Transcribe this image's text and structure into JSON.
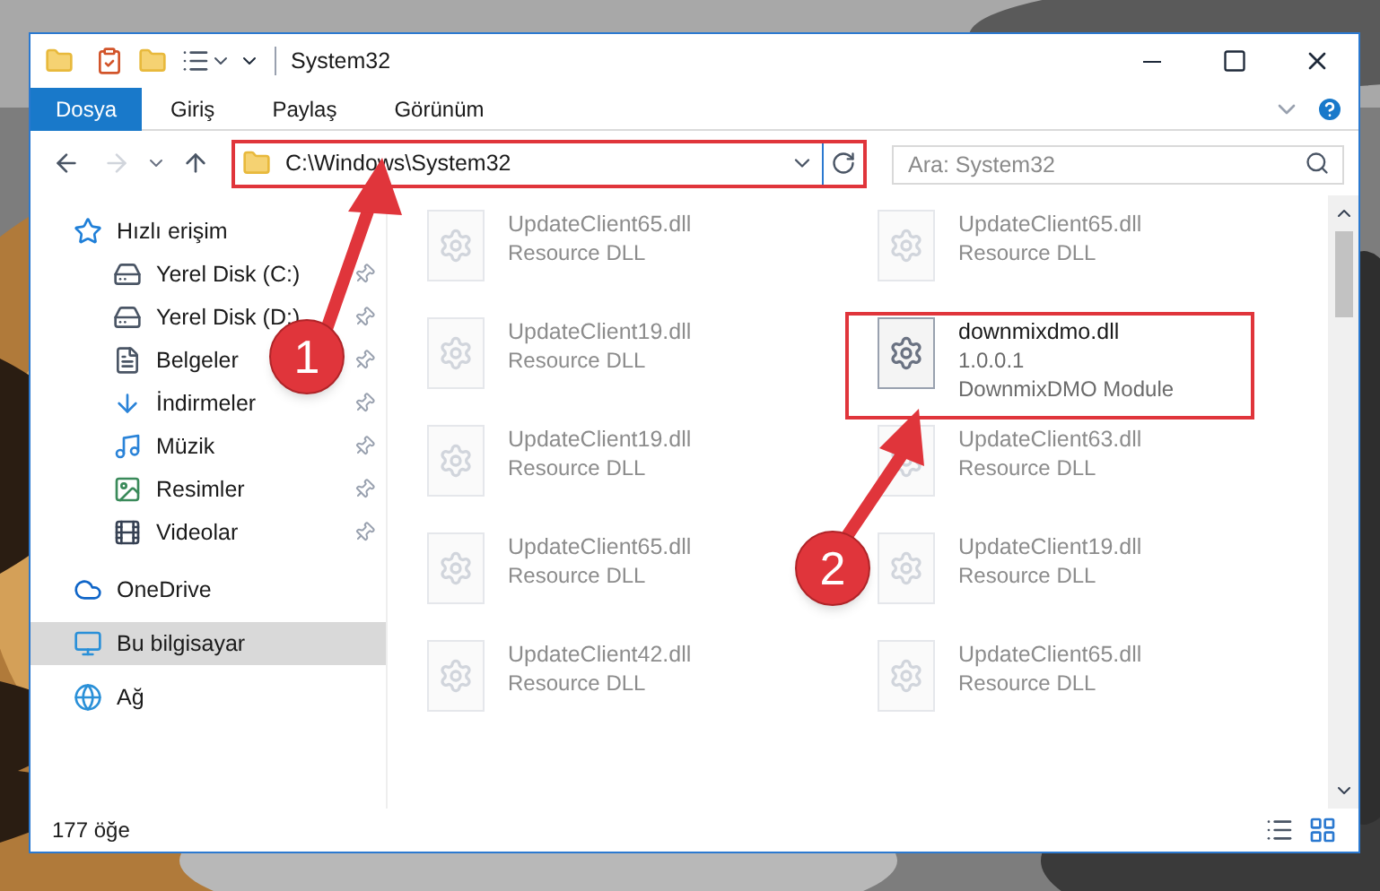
{
  "window": {
    "title": "System32"
  },
  "ribbon_tabs": [
    {
      "label": "Dosya",
      "selected": true
    },
    {
      "label": "Giriş",
      "selected": false
    },
    {
      "label": "Paylaş",
      "selected": false
    },
    {
      "label": "Görünüm",
      "selected": false
    }
  ],
  "address": {
    "path": "C:\\Windows\\System32"
  },
  "search": {
    "placeholder": "Ara: System32"
  },
  "sidebar": {
    "items": [
      {
        "label": "Hızlı erişim",
        "kind": "quick",
        "selected": false,
        "children": [
          {
            "label": "Yerel Disk (C:)",
            "kind": "disk-c",
            "pinned": true
          },
          {
            "label": "Yerel Disk (D:)",
            "kind": "disk",
            "pinned": true
          },
          {
            "label": "Belgeler",
            "kind": "documents",
            "pinned": true
          },
          {
            "label": "İndirmeler",
            "kind": "downloads",
            "pinned": true
          },
          {
            "label": "Müzik",
            "kind": "music",
            "pinned": true
          },
          {
            "label": "Resimler",
            "kind": "pictures",
            "pinned": true
          },
          {
            "label": "Videolar",
            "kind": "videos",
            "pinned": true
          }
        ]
      },
      {
        "label": "OneDrive",
        "kind": "cloud",
        "selected": false
      },
      {
        "label": "Bu bilgisayar",
        "kind": "computer",
        "selected": true
      },
      {
        "label": "Ağ",
        "kind": "network",
        "selected": false
      }
    ]
  },
  "files": [
    {
      "name": "UpdateClient65.dll",
      "details": [
        "Resource DLL"
      ],
      "faded": true
    },
    {
      "name": "UpdateClient65.dll",
      "details": [
        "Resource DLL"
      ],
      "faded": true
    },
    {
      "name": "UpdateClient19.dll",
      "details": [
        "Resource DLL"
      ],
      "faded": true
    },
    {
      "name": "downmixdmo.dll",
      "details": [
        "1.0.0.1",
        "DownmixDMO Module"
      ],
      "faded": false
    },
    {
      "name": "UpdateClient19.dll",
      "details": [
        "Resource DLL"
      ],
      "faded": true
    },
    {
      "name": "UpdateClient63.dll",
      "details": [
        "Resource DLL"
      ],
      "faded": true
    },
    {
      "name": "UpdateClient65.dll",
      "details": [
        "Resource DLL"
      ],
      "faded": true
    },
    {
      "name": "UpdateClient19.dll",
      "details": [
        "Resource DLL"
      ],
      "faded": true
    },
    {
      "name": "UpdateClient42.dll",
      "details": [
        "Resource DLL"
      ],
      "faded": true
    },
    {
      "name": "UpdateClient65.dll",
      "details": [
        "Resource DLL"
      ],
      "faded": true
    }
  ],
  "status_bar": {
    "item_count": "177 öğe"
  },
  "annotations": [
    {
      "label": "1"
    },
    {
      "label": "2"
    }
  ]
}
